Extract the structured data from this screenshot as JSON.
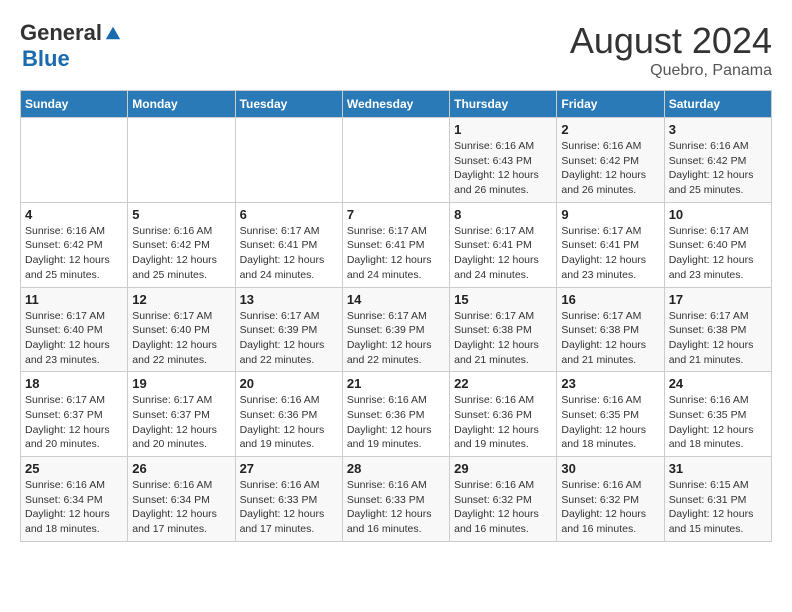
{
  "header": {
    "logo_general": "General",
    "logo_blue": "Blue",
    "month_year": "August 2024",
    "location": "Quebro, Panama"
  },
  "weekdays": [
    "Sunday",
    "Monday",
    "Tuesday",
    "Wednesday",
    "Thursday",
    "Friday",
    "Saturday"
  ],
  "weeks": [
    [
      {
        "day": "",
        "info": ""
      },
      {
        "day": "",
        "info": ""
      },
      {
        "day": "",
        "info": ""
      },
      {
        "day": "",
        "info": ""
      },
      {
        "day": "1",
        "info": "Sunrise: 6:16 AM\nSunset: 6:43 PM\nDaylight: 12 hours\nand 26 minutes."
      },
      {
        "day": "2",
        "info": "Sunrise: 6:16 AM\nSunset: 6:42 PM\nDaylight: 12 hours\nand 26 minutes."
      },
      {
        "day": "3",
        "info": "Sunrise: 6:16 AM\nSunset: 6:42 PM\nDaylight: 12 hours\nand 25 minutes."
      }
    ],
    [
      {
        "day": "4",
        "info": "Sunrise: 6:16 AM\nSunset: 6:42 PM\nDaylight: 12 hours\nand 25 minutes."
      },
      {
        "day": "5",
        "info": "Sunrise: 6:16 AM\nSunset: 6:42 PM\nDaylight: 12 hours\nand 25 minutes."
      },
      {
        "day": "6",
        "info": "Sunrise: 6:17 AM\nSunset: 6:41 PM\nDaylight: 12 hours\nand 24 minutes."
      },
      {
        "day": "7",
        "info": "Sunrise: 6:17 AM\nSunset: 6:41 PM\nDaylight: 12 hours\nand 24 minutes."
      },
      {
        "day": "8",
        "info": "Sunrise: 6:17 AM\nSunset: 6:41 PM\nDaylight: 12 hours\nand 24 minutes."
      },
      {
        "day": "9",
        "info": "Sunrise: 6:17 AM\nSunset: 6:41 PM\nDaylight: 12 hours\nand 23 minutes."
      },
      {
        "day": "10",
        "info": "Sunrise: 6:17 AM\nSunset: 6:40 PM\nDaylight: 12 hours\nand 23 minutes."
      }
    ],
    [
      {
        "day": "11",
        "info": "Sunrise: 6:17 AM\nSunset: 6:40 PM\nDaylight: 12 hours\nand 23 minutes."
      },
      {
        "day": "12",
        "info": "Sunrise: 6:17 AM\nSunset: 6:40 PM\nDaylight: 12 hours\nand 22 minutes."
      },
      {
        "day": "13",
        "info": "Sunrise: 6:17 AM\nSunset: 6:39 PM\nDaylight: 12 hours\nand 22 minutes."
      },
      {
        "day": "14",
        "info": "Sunrise: 6:17 AM\nSunset: 6:39 PM\nDaylight: 12 hours\nand 22 minutes."
      },
      {
        "day": "15",
        "info": "Sunrise: 6:17 AM\nSunset: 6:38 PM\nDaylight: 12 hours\nand 21 minutes."
      },
      {
        "day": "16",
        "info": "Sunrise: 6:17 AM\nSunset: 6:38 PM\nDaylight: 12 hours\nand 21 minutes."
      },
      {
        "day": "17",
        "info": "Sunrise: 6:17 AM\nSunset: 6:38 PM\nDaylight: 12 hours\nand 21 minutes."
      }
    ],
    [
      {
        "day": "18",
        "info": "Sunrise: 6:17 AM\nSunset: 6:37 PM\nDaylight: 12 hours\nand 20 minutes."
      },
      {
        "day": "19",
        "info": "Sunrise: 6:17 AM\nSunset: 6:37 PM\nDaylight: 12 hours\nand 20 minutes."
      },
      {
        "day": "20",
        "info": "Sunrise: 6:16 AM\nSunset: 6:36 PM\nDaylight: 12 hours\nand 19 minutes."
      },
      {
        "day": "21",
        "info": "Sunrise: 6:16 AM\nSunset: 6:36 PM\nDaylight: 12 hours\nand 19 minutes."
      },
      {
        "day": "22",
        "info": "Sunrise: 6:16 AM\nSunset: 6:36 PM\nDaylight: 12 hours\nand 19 minutes."
      },
      {
        "day": "23",
        "info": "Sunrise: 6:16 AM\nSunset: 6:35 PM\nDaylight: 12 hours\nand 18 minutes."
      },
      {
        "day": "24",
        "info": "Sunrise: 6:16 AM\nSunset: 6:35 PM\nDaylight: 12 hours\nand 18 minutes."
      }
    ],
    [
      {
        "day": "25",
        "info": "Sunrise: 6:16 AM\nSunset: 6:34 PM\nDaylight: 12 hours\nand 18 minutes."
      },
      {
        "day": "26",
        "info": "Sunrise: 6:16 AM\nSunset: 6:34 PM\nDaylight: 12 hours\nand 17 minutes."
      },
      {
        "day": "27",
        "info": "Sunrise: 6:16 AM\nSunset: 6:33 PM\nDaylight: 12 hours\nand 17 minutes."
      },
      {
        "day": "28",
        "info": "Sunrise: 6:16 AM\nSunset: 6:33 PM\nDaylight: 12 hours\nand 16 minutes."
      },
      {
        "day": "29",
        "info": "Sunrise: 6:16 AM\nSunset: 6:32 PM\nDaylight: 12 hours\nand 16 minutes."
      },
      {
        "day": "30",
        "info": "Sunrise: 6:16 AM\nSunset: 6:32 PM\nDaylight: 12 hours\nand 16 minutes."
      },
      {
        "day": "31",
        "info": "Sunrise: 6:15 AM\nSunset: 6:31 PM\nDaylight: 12 hours\nand 15 minutes."
      }
    ]
  ]
}
